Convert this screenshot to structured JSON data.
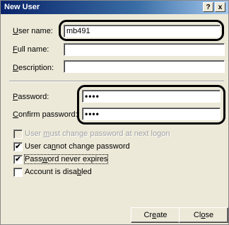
{
  "window": {
    "title": "New User",
    "help_glyph": "?",
    "close_glyph": "x"
  },
  "fields": {
    "username": {
      "label_accel": "U",
      "label_rest": "ser name:",
      "value": "mb491"
    },
    "fullname": {
      "label_accel": "F",
      "label_rest": "ull name:",
      "value": ""
    },
    "description": {
      "label_accel": "D",
      "label_rest": "escription:",
      "value": ""
    },
    "password": {
      "label_accel": "P",
      "label_rest": "assword:",
      "value": "••••"
    },
    "confirm": {
      "label_accel": "C",
      "label_rest": "onfirm password:",
      "value": "••••"
    }
  },
  "checkboxes": [
    {
      "pre": "User ",
      "accel": "m",
      "post": "ust change password at next logon",
      "checked": false,
      "disabled": true
    },
    {
      "pre": "User ca",
      "accel": "n",
      "post": "not change password",
      "checked": true,
      "disabled": false
    },
    {
      "pre": "Pass",
      "accel": "w",
      "post": "ord never expires",
      "checked": true,
      "disabled": false
    },
    {
      "pre": "Account is disa",
      "accel": "b",
      "post": "led",
      "checked": false,
      "disabled": false
    }
  ],
  "buttons": {
    "create": {
      "pre": "Cr",
      "accel": "e",
      "post": "ate"
    },
    "close": {
      "pre": "Cl",
      "accel": "o",
      "post": "se"
    }
  },
  "check_glyph": "✔"
}
